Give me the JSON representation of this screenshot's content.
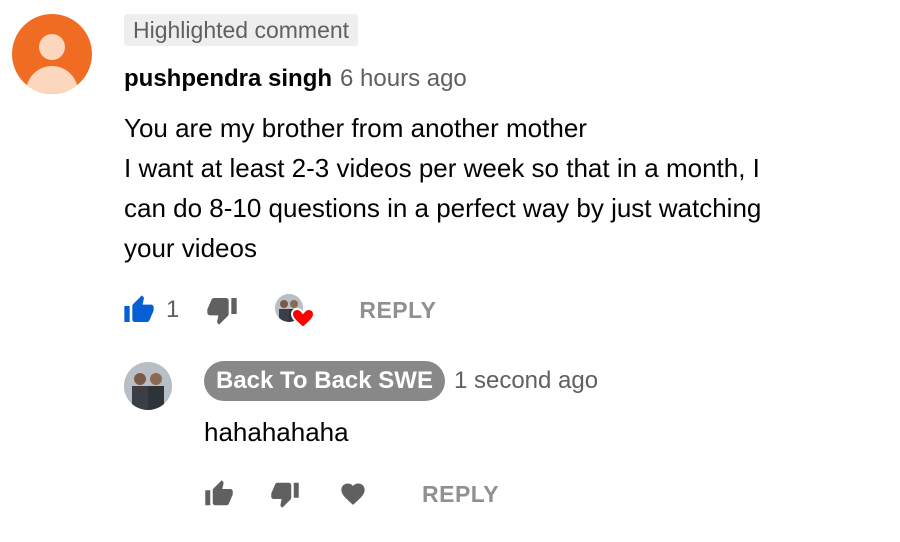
{
  "highlighted_label": "Highlighted comment",
  "comment": {
    "author": "pushpendra singh",
    "timestamp": "6 hours ago",
    "lines": [
      "You are my brother from another mother",
      "I want at least 2-3 videos per week so that in a month, I",
      "can do 8-10 questions in a perfect way by just watching",
      "your videos"
    ],
    "like_count": "1",
    "like_state": "liked",
    "creator_hearted": true,
    "reply_label": "REPLY"
  },
  "reply": {
    "author": "Back To Back SWE",
    "timestamp": "1 second ago",
    "text": "hahahahaha",
    "reply_label": "REPLY"
  },
  "colors": {
    "liked_blue": "#065fd4",
    "icon_gray": "#909090",
    "heart_red": "#ff0000",
    "default_avatar": "#ef6c22",
    "channel_chip": "#888888"
  },
  "icons": {
    "default_avatar": "person-icon",
    "like": "thumbs-up-icon",
    "dislike": "thumbs-down-icon",
    "creator_heart": "creator-heart-icon",
    "heart": "heart-icon"
  }
}
